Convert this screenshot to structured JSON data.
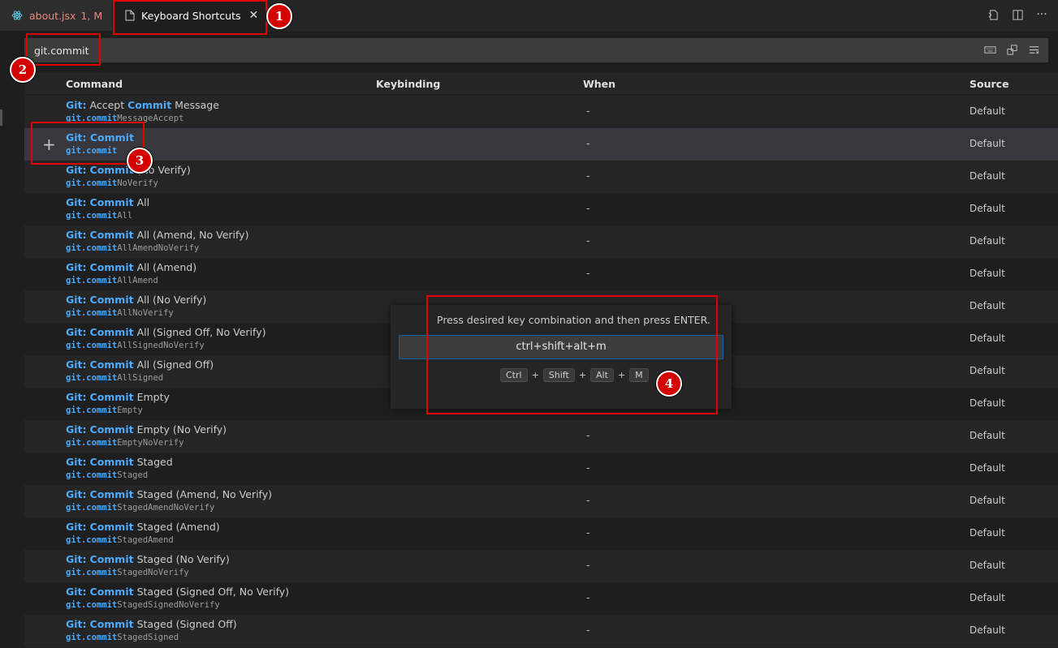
{
  "tabs": {
    "about": {
      "name": "about.jsx",
      "meta": "1, M"
    },
    "keyboard": {
      "name": "Keyboard Shortcuts"
    }
  },
  "search": {
    "value": "git.commit"
  },
  "table": {
    "headers": {
      "command": "Command",
      "keybinding": "Keybinding",
      "when": "When",
      "source": "Source"
    },
    "rows": [
      {
        "prefix": "Git:",
        "hl": "Commit",
        "prefix_mid": " Accept ",
        "rest": " Message",
        "id_hl": "git.commit",
        "id_rest": "MessageAccept",
        "when": "-",
        "source": "Default"
      },
      {
        "prefix": "Git: Commit",
        "hl": "",
        "prefix_mid": "",
        "rest": "",
        "id_hl": "git.commit",
        "id_rest": "",
        "when": "-",
        "source": "Default"
      },
      {
        "prefix": "Git:",
        "hl": "Commit",
        "prefix_mid": " ",
        "rest": " (No Verify)",
        "id_hl": "git.commit",
        "id_rest": "NoVerify",
        "when": "-",
        "source": "Default"
      },
      {
        "prefix": "Git:",
        "hl": "Commit",
        "prefix_mid": " ",
        "rest": " All",
        "id_hl": "git.commit",
        "id_rest": "All",
        "when": "-",
        "source": "Default"
      },
      {
        "prefix": "Git:",
        "hl": "Commit",
        "prefix_mid": " ",
        "rest": " All (Amend, No Verify)",
        "id_hl": "git.commit",
        "id_rest": "AllAmendNoVerify",
        "when": "-",
        "source": "Default"
      },
      {
        "prefix": "Git:",
        "hl": "Commit",
        "prefix_mid": " ",
        "rest": " All (Amend)",
        "id_hl": "git.commit",
        "id_rest": "AllAmend",
        "when": "-",
        "source": "Default"
      },
      {
        "prefix": "Git:",
        "hl": "Commit",
        "prefix_mid": " ",
        "rest": " All (No Verify)",
        "id_hl": "git.commit",
        "id_rest": "AllNoVerify",
        "when": "",
        "source": "Default"
      },
      {
        "prefix": "Git:",
        "hl": "Commit",
        "prefix_mid": " ",
        "rest": " All (Signed Off, No Verify)",
        "id_hl": "git.commit",
        "id_rest": "AllSignedNoVerify",
        "when": "",
        "source": "Default"
      },
      {
        "prefix": "Git:",
        "hl": "Commit",
        "prefix_mid": " ",
        "rest": " All (Signed Off)",
        "id_hl": "git.commit",
        "id_rest": "AllSigned",
        "when": "",
        "source": "Default"
      },
      {
        "prefix": "Git:",
        "hl": "Commit",
        "prefix_mid": " ",
        "rest": " Empty",
        "id_hl": "git.commit",
        "id_rest": "Empty",
        "when": "",
        "source": "Default"
      },
      {
        "prefix": "Git:",
        "hl": "Commit",
        "prefix_mid": " ",
        "rest": " Empty (No Verify)",
        "id_hl": "git.commit",
        "id_rest": "EmptyNoVerify",
        "when": "-",
        "source": "Default"
      },
      {
        "prefix": "Git:",
        "hl": "Commit",
        "prefix_mid": " ",
        "rest": " Staged",
        "id_hl": "git.commit",
        "id_rest": "Staged",
        "when": "-",
        "source": "Default"
      },
      {
        "prefix": "Git:",
        "hl": "Commit",
        "prefix_mid": " ",
        "rest": " Staged (Amend, No Verify)",
        "id_hl": "git.commit",
        "id_rest": "StagedAmendNoVerify",
        "when": "-",
        "source": "Default"
      },
      {
        "prefix": "Git:",
        "hl": "Commit",
        "prefix_mid": " ",
        "rest": " Staged (Amend)",
        "id_hl": "git.commit",
        "id_rest": "StagedAmend",
        "when": "-",
        "source": "Default"
      },
      {
        "prefix": "Git:",
        "hl": "Commit",
        "prefix_mid": " ",
        "rest": " Staged (No Verify)",
        "id_hl": "git.commit",
        "id_rest": "StagedNoVerify",
        "when": "-",
        "source": "Default"
      },
      {
        "prefix": "Git:",
        "hl": "Commit",
        "prefix_mid": " ",
        "rest": " Staged (Signed Off, No Verify)",
        "id_hl": "git.commit",
        "id_rest": "StagedSignedNoVerify",
        "when": "-",
        "source": "Default"
      },
      {
        "prefix": "Git:",
        "hl": "Commit",
        "prefix_mid": " ",
        "rest": " Staged (Signed Off)",
        "id_hl": "git.commit",
        "id_rest": "StagedSigned",
        "when": "-",
        "source": "Default"
      }
    ]
  },
  "dialog": {
    "message": "Press desired key combination and then press ENTER.",
    "input_value": "ctrl+shift+alt+m",
    "keys": [
      "Ctrl",
      "Shift",
      "Alt",
      "M"
    ],
    "separator": "+"
  },
  "annotations": [
    "1",
    "2",
    "3",
    "4"
  ],
  "colors": {
    "accent": "#4daafc",
    "annotation": "#e00000",
    "background": "#1e1e1e"
  }
}
